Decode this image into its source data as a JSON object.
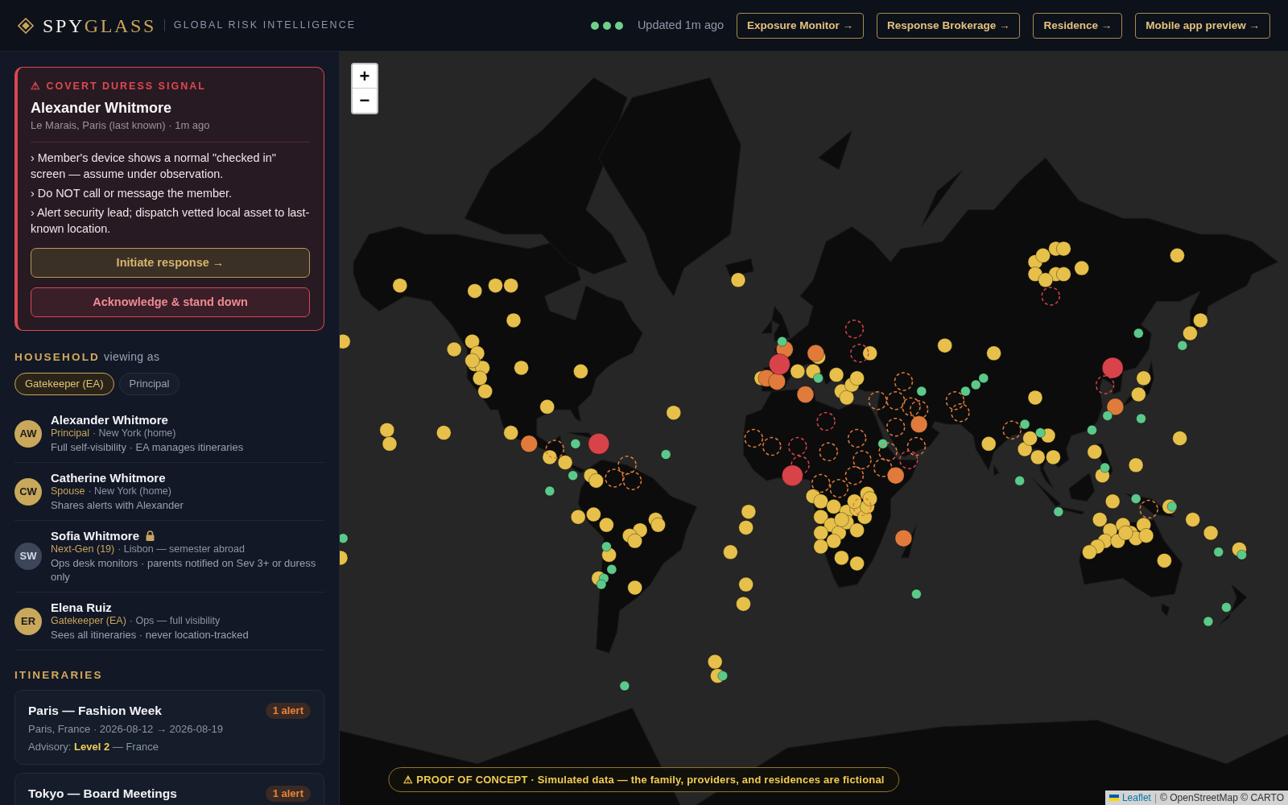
{
  "header": {
    "brand": {
      "name_light": "SPY",
      "name_accent": "GLASS"
    },
    "tagline": "GLOBAL RISK INTELLIGENCE",
    "updated": "Updated 1m ago",
    "links": [
      "Exposure Monitor →",
      "Response Brokerage →",
      "Residence →",
      "Mobile app preview →"
    ]
  },
  "alert": {
    "title": "⚠ COVERT DURESS SIGNAL",
    "member": "Alexander Whitmore",
    "location": "Le Marais, Paris (last known) · 1m ago",
    "steps": [
      "› Member's device shows a normal \"checked in\" screen — assume under observation.",
      "› Do NOT call or message the member.",
      "› Alert security lead; dispatch vetted local asset to last-known location."
    ],
    "actions": [
      {
        "label": "Initiate response →",
        "kind": "primary"
      },
      {
        "label": "Acknowledge & stand down",
        "kind": "danger"
      }
    ]
  },
  "household": {
    "heading": "HOUSEHOLD",
    "subheading": "viewing as",
    "view_as": [
      {
        "label": "Gatekeeper (EA)",
        "selected": true
      },
      {
        "label": "Principal",
        "selected": false
      }
    ],
    "members": [
      {
        "initials": "AW",
        "color": "#c9a85c",
        "name": "Alexander Whitmore",
        "locked": false,
        "role": "Principal",
        "details": "· New York (home)",
        "note": "Full self-visibility · EA manages itineraries"
      },
      {
        "initials": "CW",
        "color": "#c9a85c",
        "name": "Catherine Whitmore",
        "locked": false,
        "role": "Spouse",
        "details": "· New York (home)",
        "note": "Shares alerts with Alexander"
      },
      {
        "initials": "SW",
        "color": "#3d4659",
        "name": "Sofia Whitmore",
        "locked": true,
        "role": "Next-Gen (19)",
        "details": "· Lisbon — semester abroad",
        "note": "Ops desk monitors · parents notified on Sev 3+ or duress only"
      },
      {
        "initials": "ER",
        "color": "#c9a85c",
        "name": "Elena Ruiz",
        "locked": false,
        "role": "Gatekeeper (EA)",
        "details": "· Ops — full visibility",
        "note": "Sees all itineraries · never location-tracked"
      }
    ]
  },
  "itineraries": {
    "heading": "ITINERARIES",
    "trips": [
      {
        "title": "Paris — Fashion Week",
        "badge": "1 alert",
        "details": "Paris, France · 2026-08-12 → 2026-08-19",
        "advisory": "Advisory: **Level 2** — France"
      },
      {
        "title": "Tokyo — Board Meetings",
        "badge": "1 alert"
      }
    ]
  },
  "map": {
    "zoom_in": "+",
    "zoom_out": "−",
    "attribution": {
      "link": "Leaflet",
      "separator": "|",
      "credits": "© OpenStreetMap © CARTO"
    },
    "markers": [
      {
        "color": "#e6c04a",
        "kind": "small"
      },
      {
        "color": "#e6c04a",
        "kind": "small"
      },
      {
        "color": "#e6c04a",
        "kind": "small"
      },
      {
        "color": "#e6c04a",
        "kind": "small"
      },
      {
        "color": "#e6c04a",
        "kind": "small"
      },
      {
        "color": "#e6c04a",
        "kind": "small"
      },
      {
        "color": "#e6c04a",
        "kind": "small"
      },
      {
        "color": "#e6c04a",
        "kind": "small"
      },
      {
        "color": "#e6c04a",
        "kind": "small"
      },
      {
        "color": "#e6c04a",
        "kind": "small"
      },
      {
        "color": "#e6c04a",
        "kind": "small"
      },
      {
        "color": "#e6c04a",
        "kind": "small"
      },
      {
        "color": "#e6c04a",
        "kind": "small"
      },
      {
        "color": "#e6c04a",
        "kind": "small"
      },
      {
        "color": "#e6c04a",
        "kind": "small"
      },
      {
        "color": "#e6c04a",
        "kind": "small"
      },
      {
        "color": "#e6c04a",
        "kind": "small"
      },
      {
        "color": "#e6c04a",
        "kind": "small"
      },
      {
        "color": "#e6c04a",
        "kind": "small"
      },
      {
        "color": "#e6c04a",
        "kind": "small"
      },
      {
        "color": "#e6c04a",
        "kind": "small"
      },
      {
        "color": "#e6c04a",
        "kind": "small"
      },
      {
        "color": "#e6c04a",
        "kind": "small"
      },
      {
        "color": "#e6c04a",
        "kind": "small"
      },
      {
        "color": "#e6c04a",
        "kind": "small"
      },
      {
        "color": "#e6c04a",
        "kind": "small"
      },
      {
        "color": "#e6c04a",
        "kind": "small"
      },
      {
        "color": "#e6c04a",
        "kind": "small"
      },
      {
        "color": "#e6c04a",
        "kind": "small"
      },
      {
        "color": "#e6c04a",
        "kind": "small"
      },
      {
        "color": "#e6c04a",
        "kind": "small"
      },
      {
        "color": "#e6c04a",
        "kind": "small"
      },
      {
        "color": "#e6c04a",
        "kind": "small"
      },
      {
        "color": "#e6c04a",
        "kind": "small"
      },
      {
        "color": "#e6c04a",
        "kind": "small"
      },
      {
        "color": "#e6c04a",
        "kind": "small"
      },
      {
        "color": "#e6c04a",
        "kind": "small"
      },
      {
        "color": "#e6c04a",
        "kind": "small"
      },
      {
        "color": "#e6c04a",
        "kind": "small"
      },
      {
        "color": "#e6c04a",
        "kind": "small"
      },
      {
        "color": "#e6c04a",
        "kind": "small"
      },
      {
        "color": "#e6c04a",
        "kind": "small"
      },
      {
        "color": "#e6c04a",
        "kind": "small"
      },
      {
        "color": "#e6c04a",
        "kind": "small"
      },
      {
        "color": "#e6c04a",
        "kind": "small"
      },
      {
        "color": "#e6c04a",
        "kind": "small"
      },
      {
        "color": "#e6c04a",
        "kind": "small"
      },
      {
        "color": "#e6c04a",
        "kind": "small"
      },
      {
        "color": "#e6c04a",
        "kind": "small"
      },
      {
        "color": "#e6c04a",
        "kind": "small"
      },
      {
        "color": "#e6c04a",
        "kind": "small"
      },
      {
        "color": "#e6c04a",
        "kind": "small"
      },
      {
        "color": "#e6c04a",
        "kind": "small"
      },
      {
        "color": "#e6c04a",
        "kind": "small"
      },
      {
        "color": "#e6c04a",
        "kind": "small"
      },
      {
        "color": "#e6c04a",
        "kind": "small"
      },
      {
        "color": "#e6c04a",
        "kind": "small"
      },
      {
        "color": "#e6c04a",
        "kind": "small"
      },
      {
        "color": "#e6c04a",
        "kind": "small"
      },
      {
        "color": "#e6c04a",
        "kind": "small"
      },
      {
        "color": "#e6c04a",
        "kind": "small"
      },
      {
        "color": "#e6c04a",
        "kind": "small"
      },
      {
        "color": "#e6c04a",
        "kind": "small"
      },
      {
        "color": "#e6c04a",
        "kind": "small"
      },
      {
        "color": "#e6c04a",
        "kind": "small"
      },
      {
        "color": "#e6c04a",
        "kind": "small"
      },
      {
        "color": "#e6c04a",
        "kind": "small"
      },
      {
        "color": "#e6c04a",
        "kind": "small"
      },
      {
        "color": "#e6c04a",
        "kind": "small"
      },
      {
        "color": "#e6c04a",
        "kind": "small"
      },
      {
        "color": "#e6c04a",
        "kind": "small"
      },
      {
        "color": "#e6c04a",
        "kind": "small"
      },
      {
        "color": "#e6c04a",
        "kind": "small"
      },
      {
        "color": "#e6c04a",
        "kind": "small"
      },
      {
        "color": "#e6c04a",
        "kind": "small"
      },
      {
        "color": "#e6c04a",
        "kind": "small"
      },
      {
        "color": "#e6c04a",
        "kind": "small"
      },
      {
        "color": "#e6c04a",
        "kind": "small"
      },
      {
        "color": "#e6c04a",
        "kind": "small"
      },
      {
        "color": "#e6c04a",
        "kind": "small"
      },
      {
        "color": "#e6c04a",
        "kind": "small"
      },
      {
        "color": "#e6c04a",
        "kind": "small"
      },
      {
        "color": "#e6c04a",
        "kind": "small"
      },
      {
        "color": "#e6c04a",
        "kind": "small"
      },
      {
        "color": "#e6c04a",
        "kind": "small"
      },
      {
        "color": "#e6c04a",
        "kind": "small"
      },
      {
        "color": "#e6c04a",
        "kind": "small"
      },
      {
        "color": "#e6c04a",
        "kind": "small"
      },
      {
        "color": "#e6c04a",
        "kind": "small"
      },
      {
        "color": "#e6c04a",
        "kind": "small"
      },
      {
        "color": "#e6c04a",
        "kind": "small"
      },
      {
        "color": "#e6c04a",
        "kind": "small"
      },
      {
        "color": "#e6c04a",
        "kind": "small"
      },
      {
        "color": "#e6c04a",
        "kind": "small"
      },
      {
        "color": "#e6c04a",
        "kind": "small"
      },
      {
        "color": "#e6c04a",
        "kind": "small"
      },
      {
        "color": "#e6c04a",
        "kind": "small"
      },
      {
        "color": "#e6c04a",
        "kind": "small"
      },
      {
        "color": "#e6c04a",
        "kind": "small"
      },
      {
        "color": "#e6c04a",
        "kind": "small"
      },
      {
        "color": "#e6c04a",
        "kind": "small"
      },
      {
        "color": "#e6c04a",
        "kind": "small"
      },
      {
        "color": "#e6c04a",
        "kind": "small"
      },
      {
        "color": "#e6c04a",
        "kind": "small"
      },
      {
        "color": "#e6c04a",
        "kind": "small"
      },
      {
        "color": "#e6c04a",
        "kind": "small"
      },
      {
        "color": "#e6c04a",
        "kind": "small"
      },
      {
        "color": "#e6c04a",
        "kind": "small"
      },
      {
        "color": "#e6c04a",
        "kind": "small"
      },
      {
        "color": "#e6c04a",
        "kind": "small"
      },
      {
        "color": "#e6c04a",
        "kind": "small"
      },
      {
        "color": "#e6c04a",
        "kind": "small"
      },
      {
        "color": "#e6c04a",
        "kind": "small"
      },
      {
        "color": "#e6c04a",
        "kind": "small"
      },
      {
        "color": "#e6c04a",
        "kind": "small"
      },
      {
        "color": "#e6c04a",
        "kind": "small"
      },
      {
        "color": "#e6c04a",
        "kind": "small"
      },
      {
        "color": "#e6c04a",
        "kind": "small"
      },
      {
        "color": "#e6c04a",
        "kind": "small"
      },
      {
        "color": "#e6c04a",
        "kind": "small"
      },
      {
        "color": "#e6c04a",
        "kind": "small"
      },
      {
        "color": "#e6c04a",
        "kind": "small"
      },
      {
        "color": "#e07b3c",
        "kind": "medium"
      },
      {
        "color": "#e07b3c",
        "kind": "medium"
      },
      {
        "color": "#e07b3c",
        "kind": "medium"
      },
      {
        "color": "#e07b3c",
        "kind": "medium"
      },
      {
        "color": "#e07b3c",
        "kind": "medium"
      },
      {
        "color": "#e07b3c",
        "kind": "medium"
      },
      {
        "color": "#e07b3c",
        "kind": "medium"
      },
      {
        "color": "#e07b3c",
        "kind": "medium"
      },
      {
        "color": "#e07b3c",
        "kind": "medium"
      },
      {
        "color": "#e07b3c",
        "kind": "medium"
      },
      {
        "color": "#d8434a",
        "kind": "large"
      },
      {
        "color": "#d8434a",
        "kind": "large"
      },
      {
        "color": "#d8434a",
        "kind": "large"
      },
      {
        "color": "#d8434a",
        "kind": "large"
      },
      {
        "color": "#5cc98a",
        "kind": "dot"
      },
      {
        "color": "#5cc98a",
        "kind": "dot"
      },
      {
        "color": "#5cc98a",
        "kind": "dot"
      },
      {
        "color": "#5cc98a",
        "kind": "dot"
      },
      {
        "color": "#5cc98a",
        "kind": "dot"
      },
      {
        "color": "#5cc98a",
        "kind": "dot"
      },
      {
        "color": "#5cc98a",
        "kind": "dot"
      },
      {
        "color": "#5cc98a",
        "kind": "dot"
      },
      {
        "color": "#5cc98a",
        "kind": "dot"
      },
      {
        "color": "#5cc98a",
        "kind": "dot"
      },
      {
        "color": "#5cc98a",
        "kind": "dot"
      },
      {
        "color": "#5cc98a",
        "kind": "dot"
      },
      {
        "color": "#5cc98a",
        "kind": "dot"
      },
      {
        "color": "#5cc98a",
        "kind": "dot"
      },
      {
        "color": "#5cc98a",
        "kind": "dot"
      },
      {
        "color": "#5cc98a",
        "kind": "dot"
      },
      {
        "color": "#5cc98a",
        "kind": "dot"
      },
      {
        "color": "#5cc98a",
        "kind": "dot"
      },
      {
        "color": "#5cc98a",
        "kind": "dot"
      },
      {
        "color": "#5cc98a",
        "kind": "dot"
      },
      {
        "color": "#5cc98a",
        "kind": "dot"
      },
      {
        "color": "#5cc98a",
        "kind": "dot"
      },
      {
        "color": "#5cc98a",
        "kind": "dot"
      },
      {
        "color": "#5cc98a",
        "kind": "dot"
      },
      {
        "color": "#5cc98a",
        "kind": "dot"
      },
      {
        "color": "#5cc98a",
        "kind": "dot"
      },
      {
        "color": "#5cc98a",
        "kind": "dot"
      },
      {
        "color": "#5cc98a",
        "kind": "dot"
      },
      {
        "color": "#5cc98a",
        "kind": "dot"
      },
      {
        "color": "#5cc98a",
        "kind": "dot"
      },
      {
        "color": "#5cc98a",
        "kind": "dot"
      },
      {
        "color": "#5cc98a",
        "kind": "dot"
      },
      {
        "color": "#5cc98a",
        "kind": "dot"
      },
      {
        "color": "#5cc98a",
        "kind": "dot"
      },
      {
        "color": "#5cc98a",
        "kind": "dot"
      },
      {
        "color": "#e07b3c",
        "kind": "ring"
      },
      {
        "color": "#e07b3c",
        "kind": "ring"
      },
      {
        "color": "#e07b3c",
        "kind": "ring"
      },
      {
        "color": "#e07b3c",
        "kind": "ring"
      },
      {
        "color": "#e07b3c",
        "kind": "ring"
      },
      {
        "color": "#e07b3c",
        "kind": "ring"
      },
      {
        "color": "#e07b3c",
        "kind": "ring"
      },
      {
        "color": "#e07b3c",
        "kind": "ring"
      },
      {
        "color": "#e07b3c",
        "kind": "ring"
      },
      {
        "color": "#e07b3c",
        "kind": "ring"
      },
      {
        "color": "#e07b3c",
        "kind": "ring"
      },
      {
        "color": "#e07b3c",
        "kind": "ring"
      },
      {
        "color": "#e07b3c",
        "kind": "ring"
      },
      {
        "color": "#e07b3c",
        "kind": "ring"
      },
      {
        "color": "#e07b3c",
        "kind": "ring"
      },
      {
        "color": "#e07b3c",
        "kind": "ring"
      },
      {
        "color": "#e07b3c",
        "kind": "ring"
      },
      {
        "color": "#e07b3c",
        "kind": "ring"
      },
      {
        "color": "#e07b3c",
        "kind": "ring"
      },
      {
        "color": "#e07b3c",
        "kind": "ring"
      },
      {
        "color": "#e07b3c",
        "kind": "ring"
      },
      {
        "color": "#e07b3c",
        "kind": "ring"
      },
      {
        "color": "#e07b3c",
        "kind": "ring"
      },
      {
        "color": "#e07b3c",
        "kind": "ring"
      },
      {
        "color": "#e07b3c",
        "kind": "ring"
      },
      {
        "color": "#e07b3c",
        "kind": "ring"
      },
      {
        "color": "#d8434a",
        "kind": "ring"
      },
      {
        "color": "#d8434a",
        "kind": "ring"
      },
      {
        "color": "#d8434a",
        "kind": "ring"
      },
      {
        "color": "#d8434a",
        "kind": "ring"
      },
      {
        "color": "#d8434a",
        "kind": "ring"
      },
      {
        "color": "#d8434a",
        "kind": "ring"
      },
      {
        "color": "#d8434a",
        "kind": "ring"
      },
      {
        "color": "#d8434a",
        "kind": "ring"
      }
    ]
  },
  "banner": "⚠ PROOF OF CONCEPT · Simulated data — the family, providers, and residences are fictional"
}
